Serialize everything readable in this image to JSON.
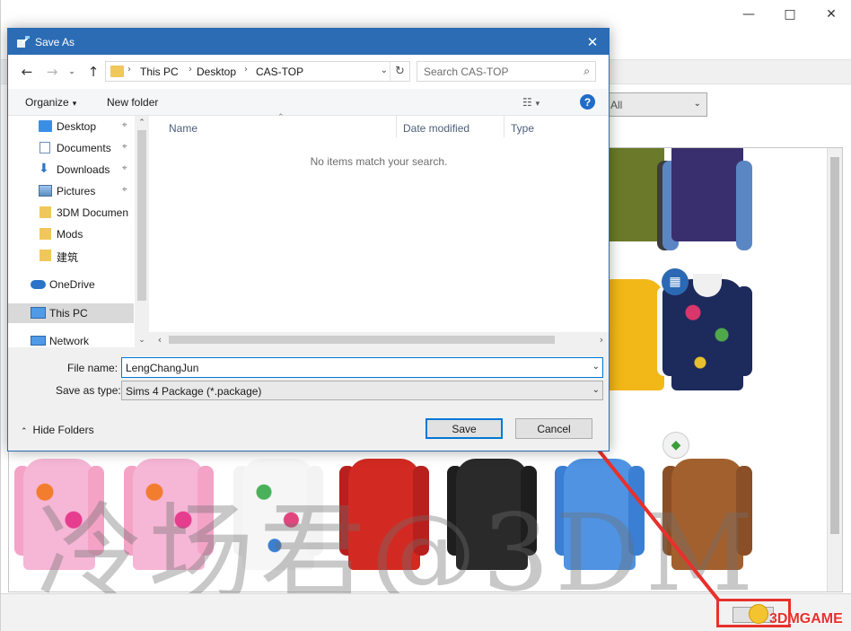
{
  "dialog": {
    "title": "Save As",
    "address": {
      "crumbs": [
        "This PC",
        "Desktop",
        "CAS-TOP"
      ]
    },
    "search": {
      "placeholder": "Search CAS-TOP"
    },
    "toolbar": {
      "organize": "Organize",
      "new_folder": "New folder"
    },
    "nav": {
      "items": [
        {
          "label": "Desktop",
          "icon": "desktop-icon",
          "pinned": true
        },
        {
          "label": "Documents",
          "icon": "documents-icon",
          "pinned": true
        },
        {
          "label": "Downloads",
          "icon": "downloads-icon",
          "pinned": true
        },
        {
          "label": "Pictures",
          "icon": "pictures-icon",
          "pinned": true
        },
        {
          "label": "3DM Documen",
          "icon": "folder-icon",
          "pinned": false
        },
        {
          "label": "Mods",
          "icon": "folder-icon",
          "pinned": false
        },
        {
          "label": "建筑",
          "icon": "folder-icon",
          "pinned": false
        },
        {
          "label": "OneDrive",
          "icon": "onedrive-icon",
          "pinned": false
        },
        {
          "label": "This PC",
          "icon": "this-pc-icon",
          "pinned": false,
          "selected": true
        },
        {
          "label": "Network",
          "icon": "network-icon",
          "pinned": false
        }
      ]
    },
    "columns": [
      "Name",
      "Date modified",
      "Type"
    ],
    "empty_message": "No items match your search.",
    "file_name_label": "File name:",
    "file_name_value": "LengChangJun",
    "save_as_type_label": "Save as type:",
    "save_as_type_value": "Sims 4 Package (*.package)",
    "hide_folders": "Hide Folders",
    "save_button": "Save",
    "cancel_button": "Cancel"
  },
  "background": {
    "filter_value": "All"
  },
  "watermark": "冷场君@3DM",
  "logo": "3DMGAME",
  "colors": {
    "accent": "#2b6cb5",
    "highlight": "#e8302c"
  }
}
